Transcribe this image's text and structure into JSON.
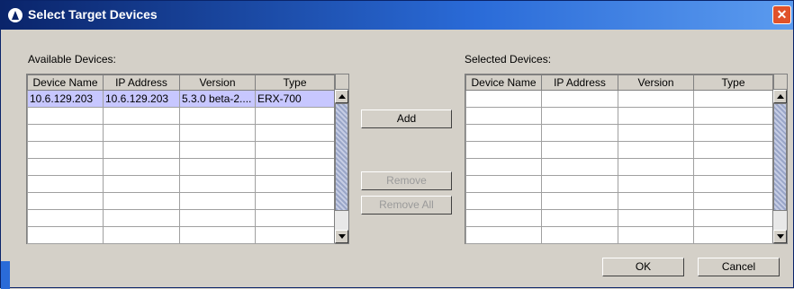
{
  "title": "Select Target Devices",
  "available": {
    "label": "Available Devices:",
    "columns": [
      "Device Name",
      "IP Address",
      "Version",
      "Type"
    ],
    "rows": [
      [
        "10.6.129.203",
        "10.6.129.203",
        "5.3.0 beta-2....",
        "ERX-700"
      ]
    ]
  },
  "selected": {
    "label": "Selected Devices:",
    "columns": [
      "Device Name",
      "IP Address",
      "Version",
      "Type"
    ],
    "rows": []
  },
  "buttons": {
    "add": "Add",
    "remove": "Remove",
    "remove_all": "Remove All",
    "ok": "OK",
    "cancel": "Cancel"
  },
  "icons": {
    "close": "close-icon",
    "app": "app-icon"
  }
}
